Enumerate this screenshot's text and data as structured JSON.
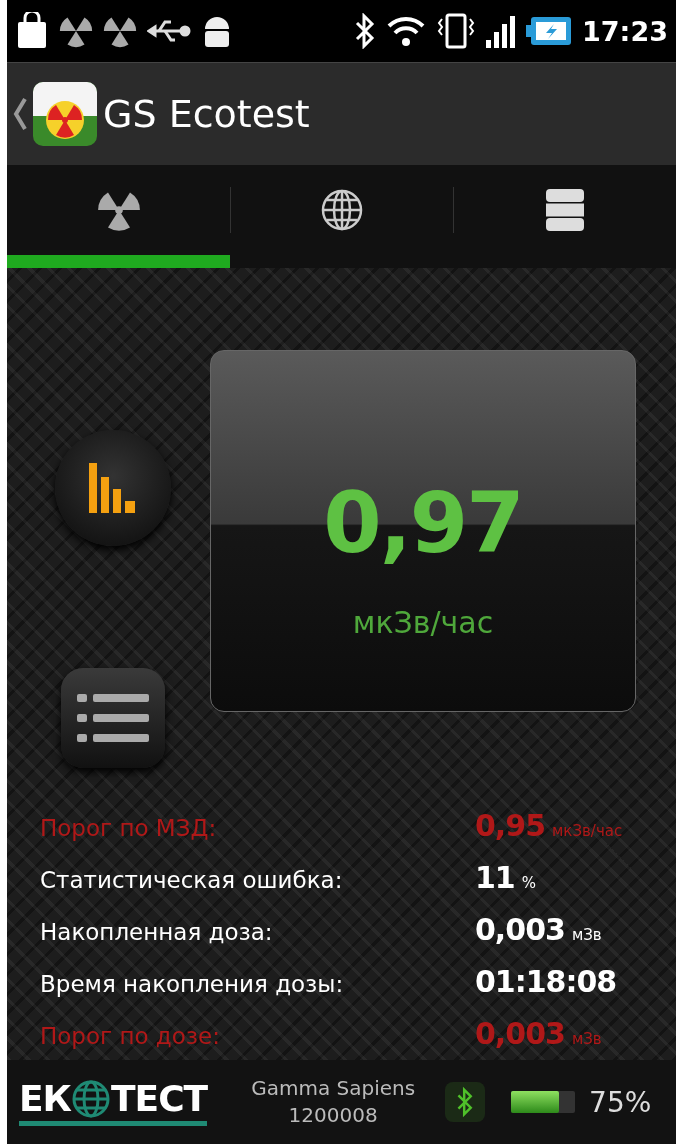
{
  "status_bar": {
    "time": "17:23"
  },
  "app_bar": {
    "title": "GS Ecotest"
  },
  "tabs": [
    {
      "kind": "radiation",
      "selected": true
    },
    {
      "kind": "globe",
      "selected": false
    },
    {
      "kind": "stack",
      "selected": false
    }
  ],
  "meter": {
    "value": "0,97",
    "unit": "мкЗв/час"
  },
  "readings": [
    {
      "label": "Порог по МЗД:",
      "value": "0,95",
      "unit": "мкЗв/час",
      "alert": true
    },
    {
      "label": "Статистическая ошибка:",
      "value": "11",
      "unit": "%",
      "alert": false
    },
    {
      "label": "Накопленная доза:",
      "value": "0,003",
      "unit": "мЗв",
      "alert": false
    },
    {
      "label": "Время накопления дозы:",
      "value": "01:18:08",
      "alert": false
    },
    {
      "label": "Порог по дозе:",
      "value": "0,003",
      "unit": "мЗв",
      "alert": true
    }
  ],
  "footer": {
    "logo": {
      "left": "ЕК",
      "right": "ТЕСТ"
    },
    "device_name": "Gamma Sapiens",
    "serial": "1200008",
    "battery": {
      "level": 0.75,
      "reading": "75%"
    }
  }
}
